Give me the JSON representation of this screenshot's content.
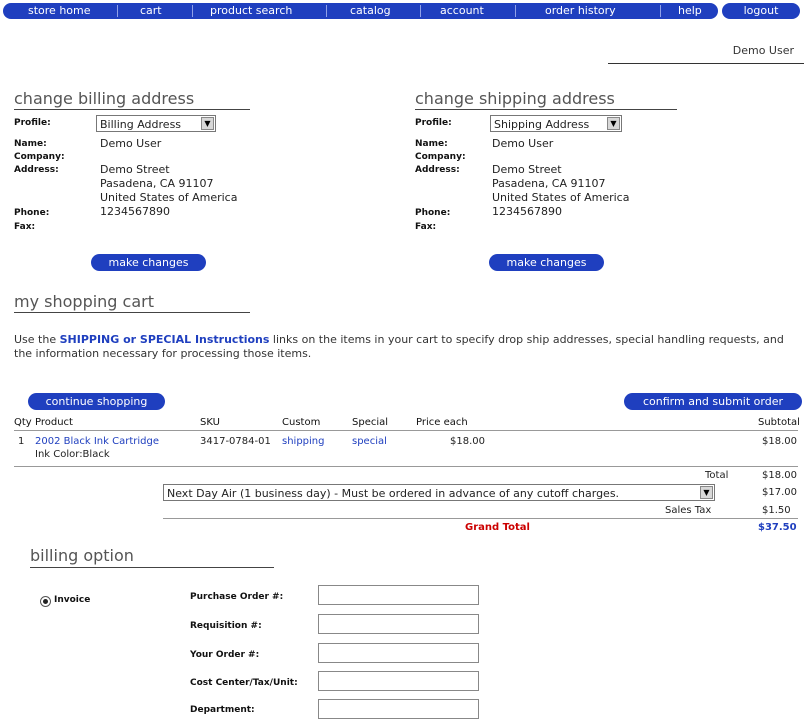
{
  "nav": {
    "items": [
      "store home",
      "cart",
      "product search",
      "catalog",
      "account",
      "order history",
      "help"
    ],
    "last": "logout"
  },
  "user": {
    "name": "Demo User"
  },
  "billing": {
    "title": "change billing address",
    "profile_label": "Profile:",
    "profile_value": "Billing Address",
    "name_label": "Name:",
    "name_value": "Demo User",
    "company_label": "Company:",
    "address_label": "Address:",
    "address_lines": [
      "Demo Street",
      "Pasadena, CA 91107",
      "United States of America"
    ],
    "phone_label": "Phone:",
    "phone_value": "1234567890",
    "fax_label": "Fax:",
    "button": "make changes"
  },
  "shipping": {
    "title": "change shipping address",
    "profile_label": "Profile:",
    "profile_value": "Shipping Address",
    "name_label": "Name:",
    "name_value": "Demo User",
    "company_label": "Company:",
    "address_label": "Address:",
    "address_lines": [
      "Demo Street",
      "Pasadena, CA 91107",
      "United States of America"
    ],
    "phone_label": "Phone:",
    "phone_value": "1234567890",
    "fax_label": "Fax:",
    "button": "make changes"
  },
  "cart": {
    "title": "my shopping cart",
    "intro_before": "Use the ",
    "intro_link": "SHIPPING or SPECIAL Instructions",
    "intro_after": " links on the items in your cart to specify drop ship addresses, special handling requests, and the information necessary for processing those items.",
    "continue_button": "continue shopping",
    "confirm_button": "confirm and submit order",
    "headers": {
      "qty": "Qty",
      "product": "Product",
      "sku": "SKU",
      "custom": "Custom",
      "special": "Special",
      "price": "Price each",
      "subtotal": "Subtotal"
    },
    "items": [
      {
        "qty": "1",
        "product": "2002 Black Ink Cartridge",
        "product_sub": "Ink Color:Black",
        "sku": "3417-0784-01",
        "custom": "shipping",
        "special": "special",
        "price": "$18.00",
        "subtotal": "$18.00"
      }
    ],
    "total_label": "Total",
    "total_value": "$18.00",
    "shipping_option": "Next Day Air (1 business day) - Must be ordered in advance of any cutoff charges.",
    "shipping_value": "$17.00",
    "sales_tax_label": "Sales Tax",
    "sales_tax_value": "$1.50",
    "grand_total_label": "Grand Total",
    "grand_total_value": "$37.50"
  },
  "billing_option": {
    "title": "billing option",
    "radio_label": "Invoice",
    "fields": [
      {
        "label": "Purchase Order #:",
        "value": ""
      },
      {
        "label": "Requisition #:",
        "value": ""
      },
      {
        "label": "Your Order #:",
        "value": ""
      },
      {
        "label": "Cost Center/Tax/Unit:",
        "value": ""
      },
      {
        "label": "Department:",
        "value": ""
      }
    ]
  },
  "colors": {
    "brand": "#1f3fbf",
    "grand_total": "#cc0000"
  }
}
